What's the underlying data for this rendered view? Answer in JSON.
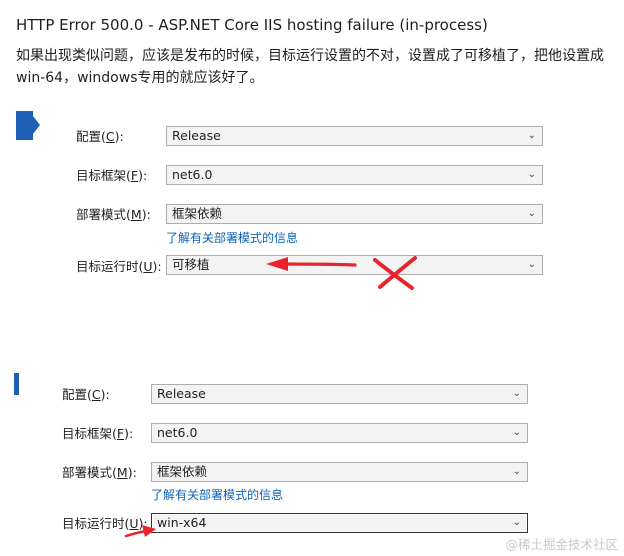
{
  "title": "HTTP Error 500.0 - ASP.NET Core IIS hosting failure (in-process)",
  "paragraph": {
    "line1": "如果出现类似问题，应该是发布的时候，目标运行设置的不对，设置成了可移植了，把他设置成",
    "line2": "win-64，windows专用的就应该好了。"
  },
  "panel_before": {
    "config_label": "配置(",
    "config_key": "C",
    "config_label_end": "):",
    "config_value": "Release",
    "framework_label": "目标框架(",
    "framework_key": "F",
    "framework_label_end": "):",
    "framework_value": "net6.0",
    "deploy_label": "部署模式(",
    "deploy_key": "M",
    "deploy_label_end": "):",
    "deploy_value": "框架依赖",
    "deploy_link": "了解有关部署模式的信息",
    "runtime_label": "目标运行时(",
    "runtime_key": "U",
    "runtime_label_end": "):",
    "runtime_value": "可移植"
  },
  "panel_after": {
    "config_label": "配置(",
    "config_key": "C",
    "config_label_end": "):",
    "config_value": "Release",
    "framework_label": "目标框架(",
    "framework_key": "F",
    "framework_label_end": "):",
    "framework_value": "net6.0",
    "deploy_label": "部署模式(",
    "deploy_key": "M",
    "deploy_label_end": "):",
    "deploy_value": "框架依赖",
    "deploy_link": "了解有关部署模式的信息",
    "runtime_label": "目标运行时(",
    "runtime_key": "U",
    "runtime_label_end": "):",
    "runtime_value": "win-x64"
  },
  "icons": {
    "dropdown": "chevron-down-icon",
    "annotation_arrow": "red-arrow-icon",
    "annotation_cross": "red-x-icon"
  },
  "colors": {
    "link": "#0b63b6",
    "accent_marker": "#1f5fb6",
    "annotation": "#e8232b"
  },
  "watermark": "@稀土掘金技术社区"
}
